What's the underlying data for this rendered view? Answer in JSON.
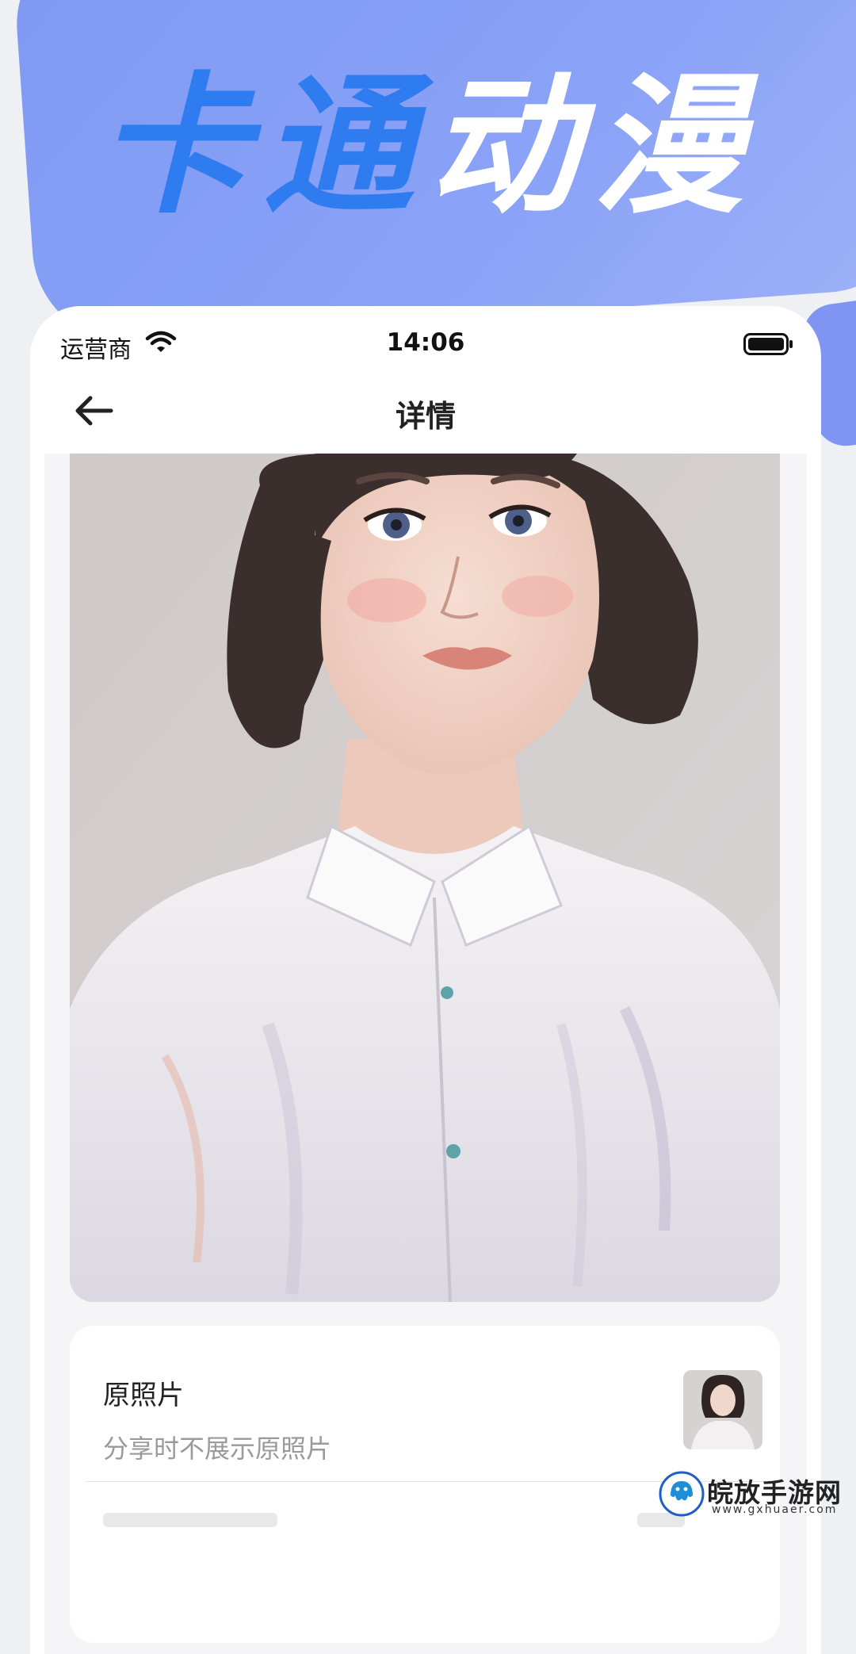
{
  "promo": {
    "title_part1": "卡通",
    "title_part2": "动漫",
    "accent_color": "#2f7bf0",
    "bg_color": "#8aa2f7"
  },
  "status_bar": {
    "carrier": "运营商",
    "time": "14:06",
    "wifi_icon": "wifi-icon",
    "battery_icon": "battery-icon"
  },
  "nav": {
    "back_icon": "back-arrow-icon",
    "title": "详情"
  },
  "artwork": {
    "subject": "cartoon-portrait-illustration"
  },
  "info": {
    "row1_title": "原照片",
    "row1_subtitle": "分享时不展示原照片"
  },
  "watermark": {
    "text": "皖放手游网",
    "url": "www.gxhuaer.com"
  }
}
